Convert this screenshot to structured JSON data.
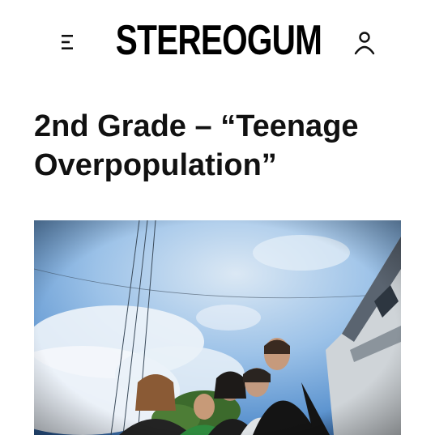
{
  "header": {
    "logo_text": "STEREOGUM",
    "menu_icon": "menu-icon",
    "account_icon": "user-icon"
  },
  "article": {
    "headline": "2nd Grade – “Teenage Overpopulation”"
  },
  "colors": {
    "sky_top": "#7fb2e3",
    "sky_light": "#d6e6f3",
    "cloud": "#f2f6fa",
    "text": "#111111"
  }
}
